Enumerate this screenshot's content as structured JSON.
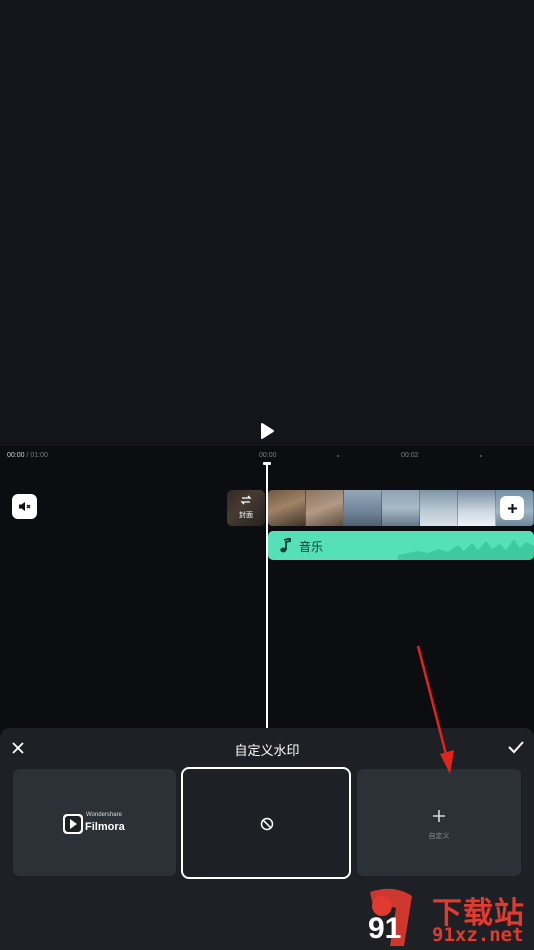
{
  "timeline": {
    "current_time": "00:00",
    "total_time": "/ 01:00",
    "ruler": [
      "00:00",
      "00:02"
    ]
  },
  "tracks": {
    "cover_label": "封面",
    "audio_label": "音乐"
  },
  "panel": {
    "title": "自定义水印",
    "options": [
      {
        "brand_small": "Wondershare",
        "brand": "Filmora"
      },
      {
        "name": "none"
      },
      {
        "label": "自定义"
      }
    ]
  },
  "watermark": {
    "site_cn": "下载站",
    "site_url": "91xz.net",
    "logo_text": "91"
  },
  "colors": {
    "accent_audio": "#55e0b8",
    "panel_bg": "#1d2025",
    "card_bg": "#2c3037",
    "arrow": "#e0241b"
  },
  "icons": [
    "play-icon",
    "speaker-icon",
    "swap-icon",
    "plus-icon",
    "music-note-icon",
    "close-icon",
    "check-icon",
    "no-watermark-icon"
  ]
}
